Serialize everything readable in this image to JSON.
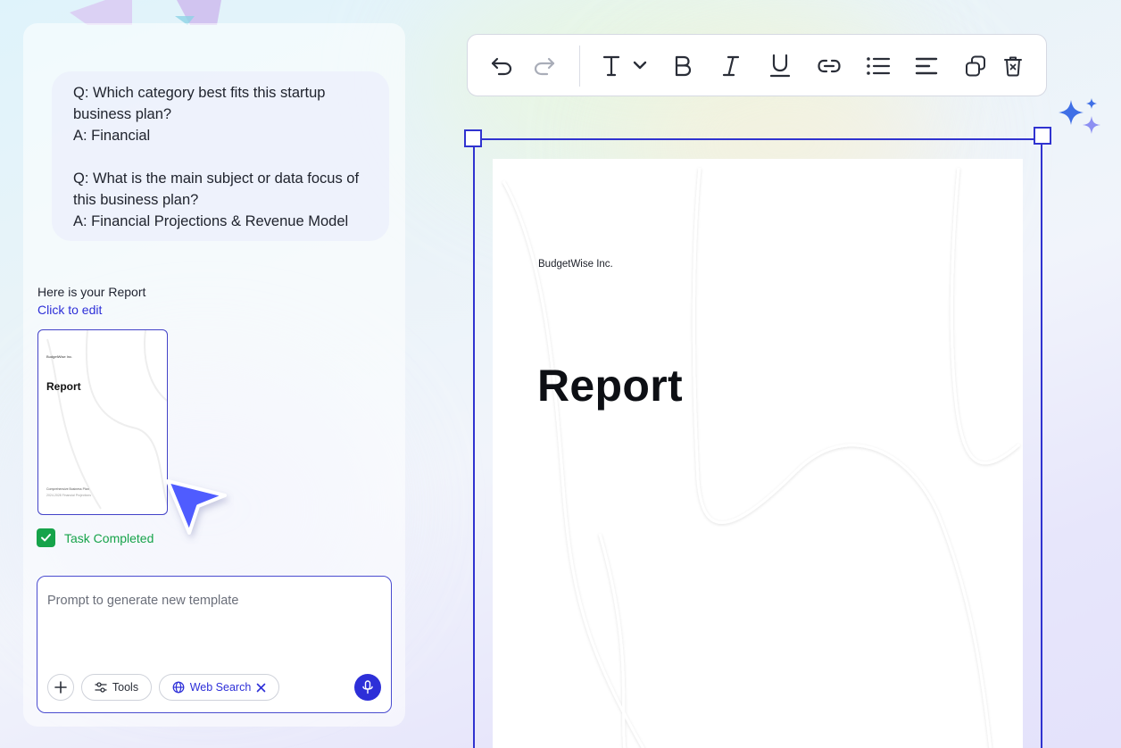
{
  "chat": {
    "qa": [
      {
        "q": "Q: Which category best fits this startup business plan?",
        "a": "A: Financial"
      },
      {
        "q": "Q: What is the main subject or data focus of this business plan?",
        "a": "A: Financial Projections & Revenue Model"
      }
    ],
    "report_label": "Here is your Report",
    "edit_link": "Click to edit",
    "task_status": "Task Completed"
  },
  "thumbnail": {
    "company": "BudgetWise Inc.",
    "title": "Report",
    "footer_line1": "Comprehensive Business Plan",
    "footer_line2": "2024-2028 Financial Projections"
  },
  "prompt": {
    "placeholder": "Prompt to generate new template",
    "tools_label": "Tools",
    "web_search_label": "Web Search"
  },
  "toolbar": {
    "icons": [
      "undo-icon",
      "redo-icon",
      "text-style-icon",
      "chevron-down-icon",
      "bold-icon",
      "italic-icon",
      "underline-icon",
      "link-icon",
      "bullet-list-icon",
      "align-left-icon",
      "duplicate-icon",
      "trash-icon"
    ]
  },
  "document": {
    "company": "BudgetWise Inc.",
    "title": "Report"
  },
  "colors": {
    "accent": "#3033d0",
    "success": "#16a34a",
    "link": "#2d2fd8"
  }
}
